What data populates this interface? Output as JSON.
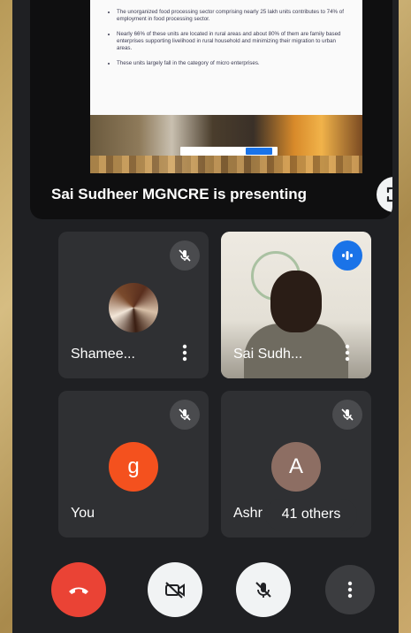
{
  "presentation": {
    "bullets": [
      "The unorganized food processing sector comprising nearly 25 lakh units contributes to 74% of employment in food processing sector.",
      "Nearly 66% of these units are located in rural areas and about 80% of them are family based enterprises supporting livelihood in rural household and minimizing their migration to urban areas.",
      "These units largely fall in the category of micro enterprises."
    ],
    "presenting_label": "Sai Sudheer MGNCRE is presenting"
  },
  "participants": [
    {
      "name": "Shamee...",
      "type": "photo",
      "muted": true
    },
    {
      "name": "Sai Sudh...",
      "type": "video",
      "speaking": true
    },
    {
      "name": "You",
      "type": "initial",
      "initial": "g",
      "avatar_color": "#f4511e",
      "muted": true
    },
    {
      "name": "Ashr",
      "type": "initial",
      "initial": "A",
      "avatar_color": "#8d6e63",
      "muted": true
    }
  ],
  "others_label": "41 others",
  "controls": {
    "end_call_color": "#ea4335",
    "camera_state": "off",
    "mic_state": "off"
  },
  "colors": {
    "frame_bg": "#1f2023",
    "tile_bg": "#2f3033",
    "accent": "#1a73e8"
  }
}
